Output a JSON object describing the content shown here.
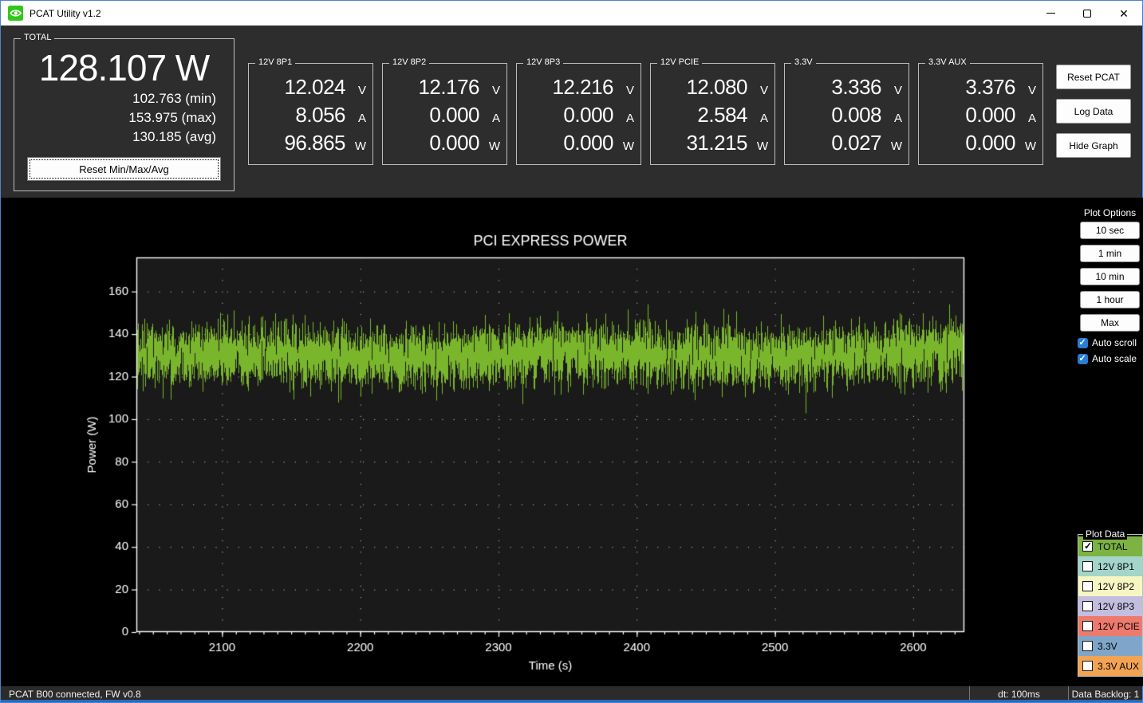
{
  "window": {
    "title": "PCAT Utility v1.2"
  },
  "units": [
    "V",
    "A",
    "W"
  ],
  "total": {
    "label": "TOTAL",
    "power": "128.107 W",
    "min": "102.763 (min)",
    "max": "153.975 (max)",
    "avg": "130.185 (avg)",
    "reset_button": "Reset Min/Max/Avg"
  },
  "channels": [
    {
      "label": "12V 8P1",
      "volts": "12.024",
      "amps": "8.056",
      "watts": "96.865"
    },
    {
      "label": "12V 8P2",
      "volts": "12.176",
      "amps": "0.000",
      "watts": "0.000"
    },
    {
      "label": "12V 8P3",
      "volts": "12.216",
      "amps": "0.000",
      "watts": "0.000"
    },
    {
      "label": "12V PCIE",
      "volts": "12.080",
      "amps": "2.584",
      "watts": "31.215"
    },
    {
      "label": "3.3V",
      "volts": "3.336",
      "amps": "0.008",
      "watts": "0.027"
    },
    {
      "label": "3.3V AUX",
      "volts": "3.376",
      "amps": "0.000",
      "watts": "0.000"
    }
  ],
  "actions": {
    "reset_pcat": "Reset PCAT",
    "log_data": "Log Data",
    "hide_graph": "Hide Graph"
  },
  "plot_options": {
    "title": "Plot Options",
    "buttons": [
      "10 sec",
      "1 min",
      "10 min",
      "1 hour",
      "Max"
    ],
    "checkboxes": [
      {
        "label": "Auto scroll",
        "checked": true
      },
      {
        "label": "Auto scale",
        "checked": true
      }
    ]
  },
  "plot_data": {
    "title": "Plot Data",
    "series": [
      {
        "label": "TOTAL",
        "color": "#7cb342",
        "checked": true
      },
      {
        "label": "12V 8P1",
        "color": "#a3d5ca",
        "checked": false
      },
      {
        "label": "12V 8P2",
        "color": "#f6f6c3",
        "checked": false
      },
      {
        "label": "12V 8P3",
        "color": "#c3bddf",
        "checked": false
      },
      {
        "label": "12V PCIE",
        "color": "#ee7a6e",
        "checked": false
      },
      {
        "label": "3.3V",
        "color": "#7fa6c9",
        "checked": false
      },
      {
        "label": "3.3V AUX",
        "color": "#f2a454",
        "checked": false
      }
    ]
  },
  "status_bar": {
    "connection": "PCAT B00 connected, FW v0.8",
    "dt": "dt: 100ms",
    "backlog": "Data Backlog: 1"
  },
  "chart_data": {
    "type": "line",
    "title": "PCI EXPRESS POWER",
    "xlabel": "Time (s)",
    "ylabel": "Power (W)",
    "xlim": [
      2038,
      2637
    ],
    "ylim": [
      0,
      176
    ],
    "x_ticks": [
      2100,
      2200,
      2300,
      2400,
      2500,
      2600
    ],
    "y_ticks": [
      0,
      20,
      40,
      60,
      80,
      100,
      120,
      140,
      160
    ],
    "x_minor_step": 10,
    "grid": true,
    "plot_background": "#1a1a1a",
    "axis_color": "#ffffff",
    "series": [
      {
        "name": "TOTAL",
        "color": "#7ab62c",
        "mean": 130.185,
        "min": 102.763,
        "max": 153.975,
        "std": 7.0,
        "sample_dt": 0.1,
        "seed": 1337
      }
    ]
  }
}
